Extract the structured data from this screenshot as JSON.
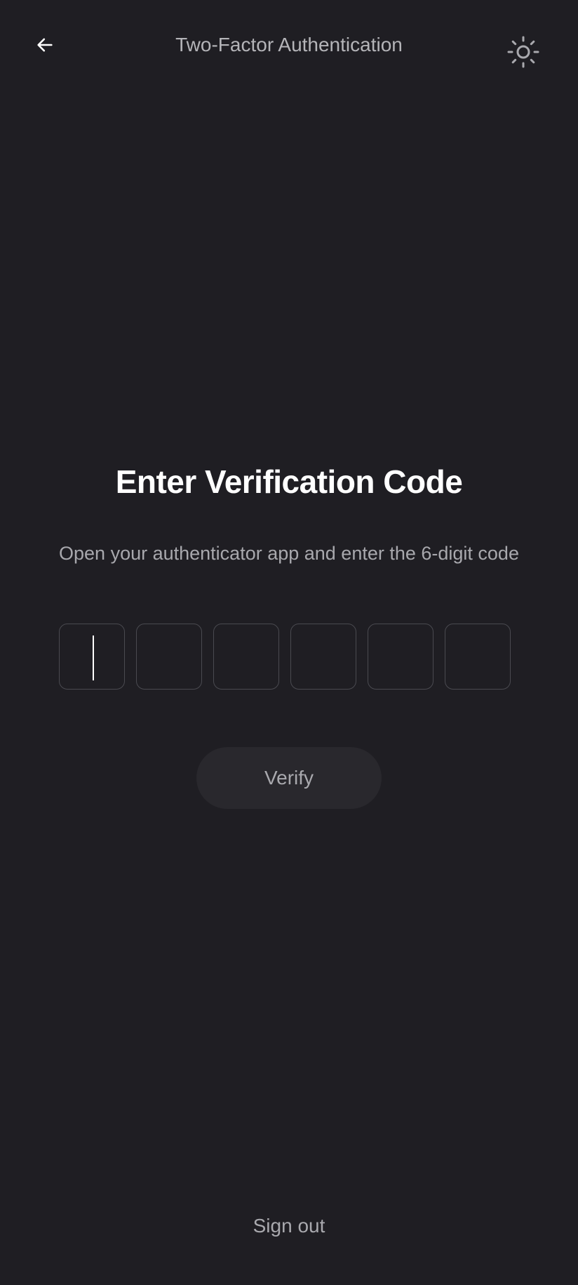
{
  "header": {
    "title": "Two-Factor Authentication",
    "back_icon": "arrow-left-icon",
    "theme_icon": "sun-icon"
  },
  "main": {
    "heading": "Enter Verification Code",
    "subtitle": "Open your authenticator app and enter the 6-digit code",
    "code_digits": [
      "",
      "",
      "",
      "",
      "",
      ""
    ],
    "verify_label": "Verify"
  },
  "footer": {
    "sign_out_label": "Sign out"
  },
  "colors": {
    "background": "#1f1e23",
    "muted_text": "#a9a9ae",
    "box_border": "#4a4a50",
    "button_bg": "#29282d"
  }
}
